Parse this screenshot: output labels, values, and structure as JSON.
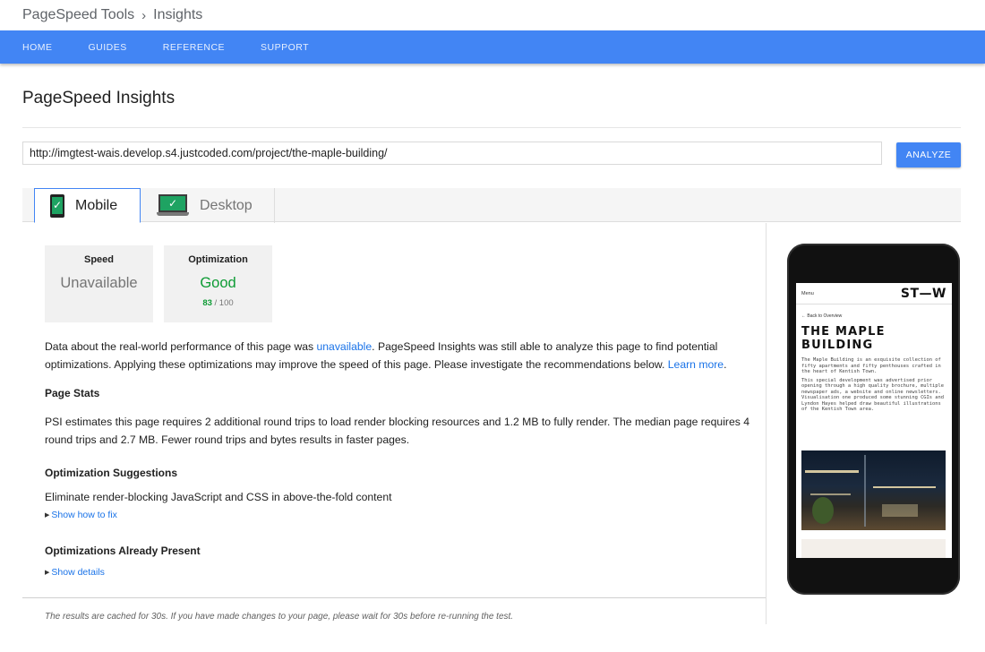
{
  "breadcrumb": {
    "parent": "PageSpeed Tools",
    "separator": "›",
    "current": "Insights"
  },
  "nav": {
    "items": [
      "HOME",
      "GUIDES",
      "REFERENCE",
      "SUPPORT"
    ]
  },
  "page": {
    "title": "PageSpeed Insights"
  },
  "url_form": {
    "value": "http://imgtest-wais.develop.s4.justcoded.com/project/the-maple-building/",
    "button": "ANALYZE"
  },
  "tabs": [
    {
      "label": "Mobile",
      "icon": "phone-check-icon",
      "active": true
    },
    {
      "label": "Desktop",
      "icon": "monitor-check-icon",
      "active": false
    }
  ],
  "scores": {
    "speed": {
      "name": "Speed",
      "value": "Unavailable"
    },
    "optimization": {
      "name": "Optimization",
      "value": "Good",
      "score": "83",
      "out_of": "/ 100"
    }
  },
  "intro": {
    "part1": "Data about the real-world performance of this page was ",
    "link1": "unavailable",
    "part2": ". PageSpeed Insights was still able to analyze this page to find potential optimizations. Applying these optimizations may improve the speed of this page. Please investigate the recommendations below. ",
    "link2": "Learn more",
    "part3": "."
  },
  "page_stats": {
    "heading": "Page Stats",
    "text": "PSI estimates this page requires 2 additional round trips to load render blocking resources and 1.2 MB to fully render. The median page requires 4 round trips and 2.7 MB. Fewer round trips and bytes results in faster pages."
  },
  "suggestions": {
    "heading": "Optimization Suggestions",
    "item": "Eliminate render-blocking JavaScript and CSS in above-the-fold content",
    "link": "Show how to fix"
  },
  "present": {
    "heading": "Optimizations Already Present",
    "link": "Show details"
  },
  "footer": {
    "note": "The results are cached for 30s. If you have made changes to your page, please wait for 30s before re-running the test."
  },
  "preview": {
    "menu": "Menu",
    "logo": "ST—W",
    "back": "←  Back to Overview",
    "title": "THE MAPLE BUILDING",
    "p1": "The Maple Building is an exquisite collection of fifty apartments and fifty penthouses crafted in the heart of Kentish Town.",
    "p2": "This special development was advertised prior opening through a high quality brochure, multiple newspaper ads, a website and online newsletters. Visualisation one produced some stunning CGIs and Lyndon Hayes helped draw beautiful illustrations of the Kentish Town area."
  },
  "colors": {
    "brand_blue": "#4285f4",
    "good_green": "#0d9b34",
    "link_blue": "#1a73e8"
  }
}
